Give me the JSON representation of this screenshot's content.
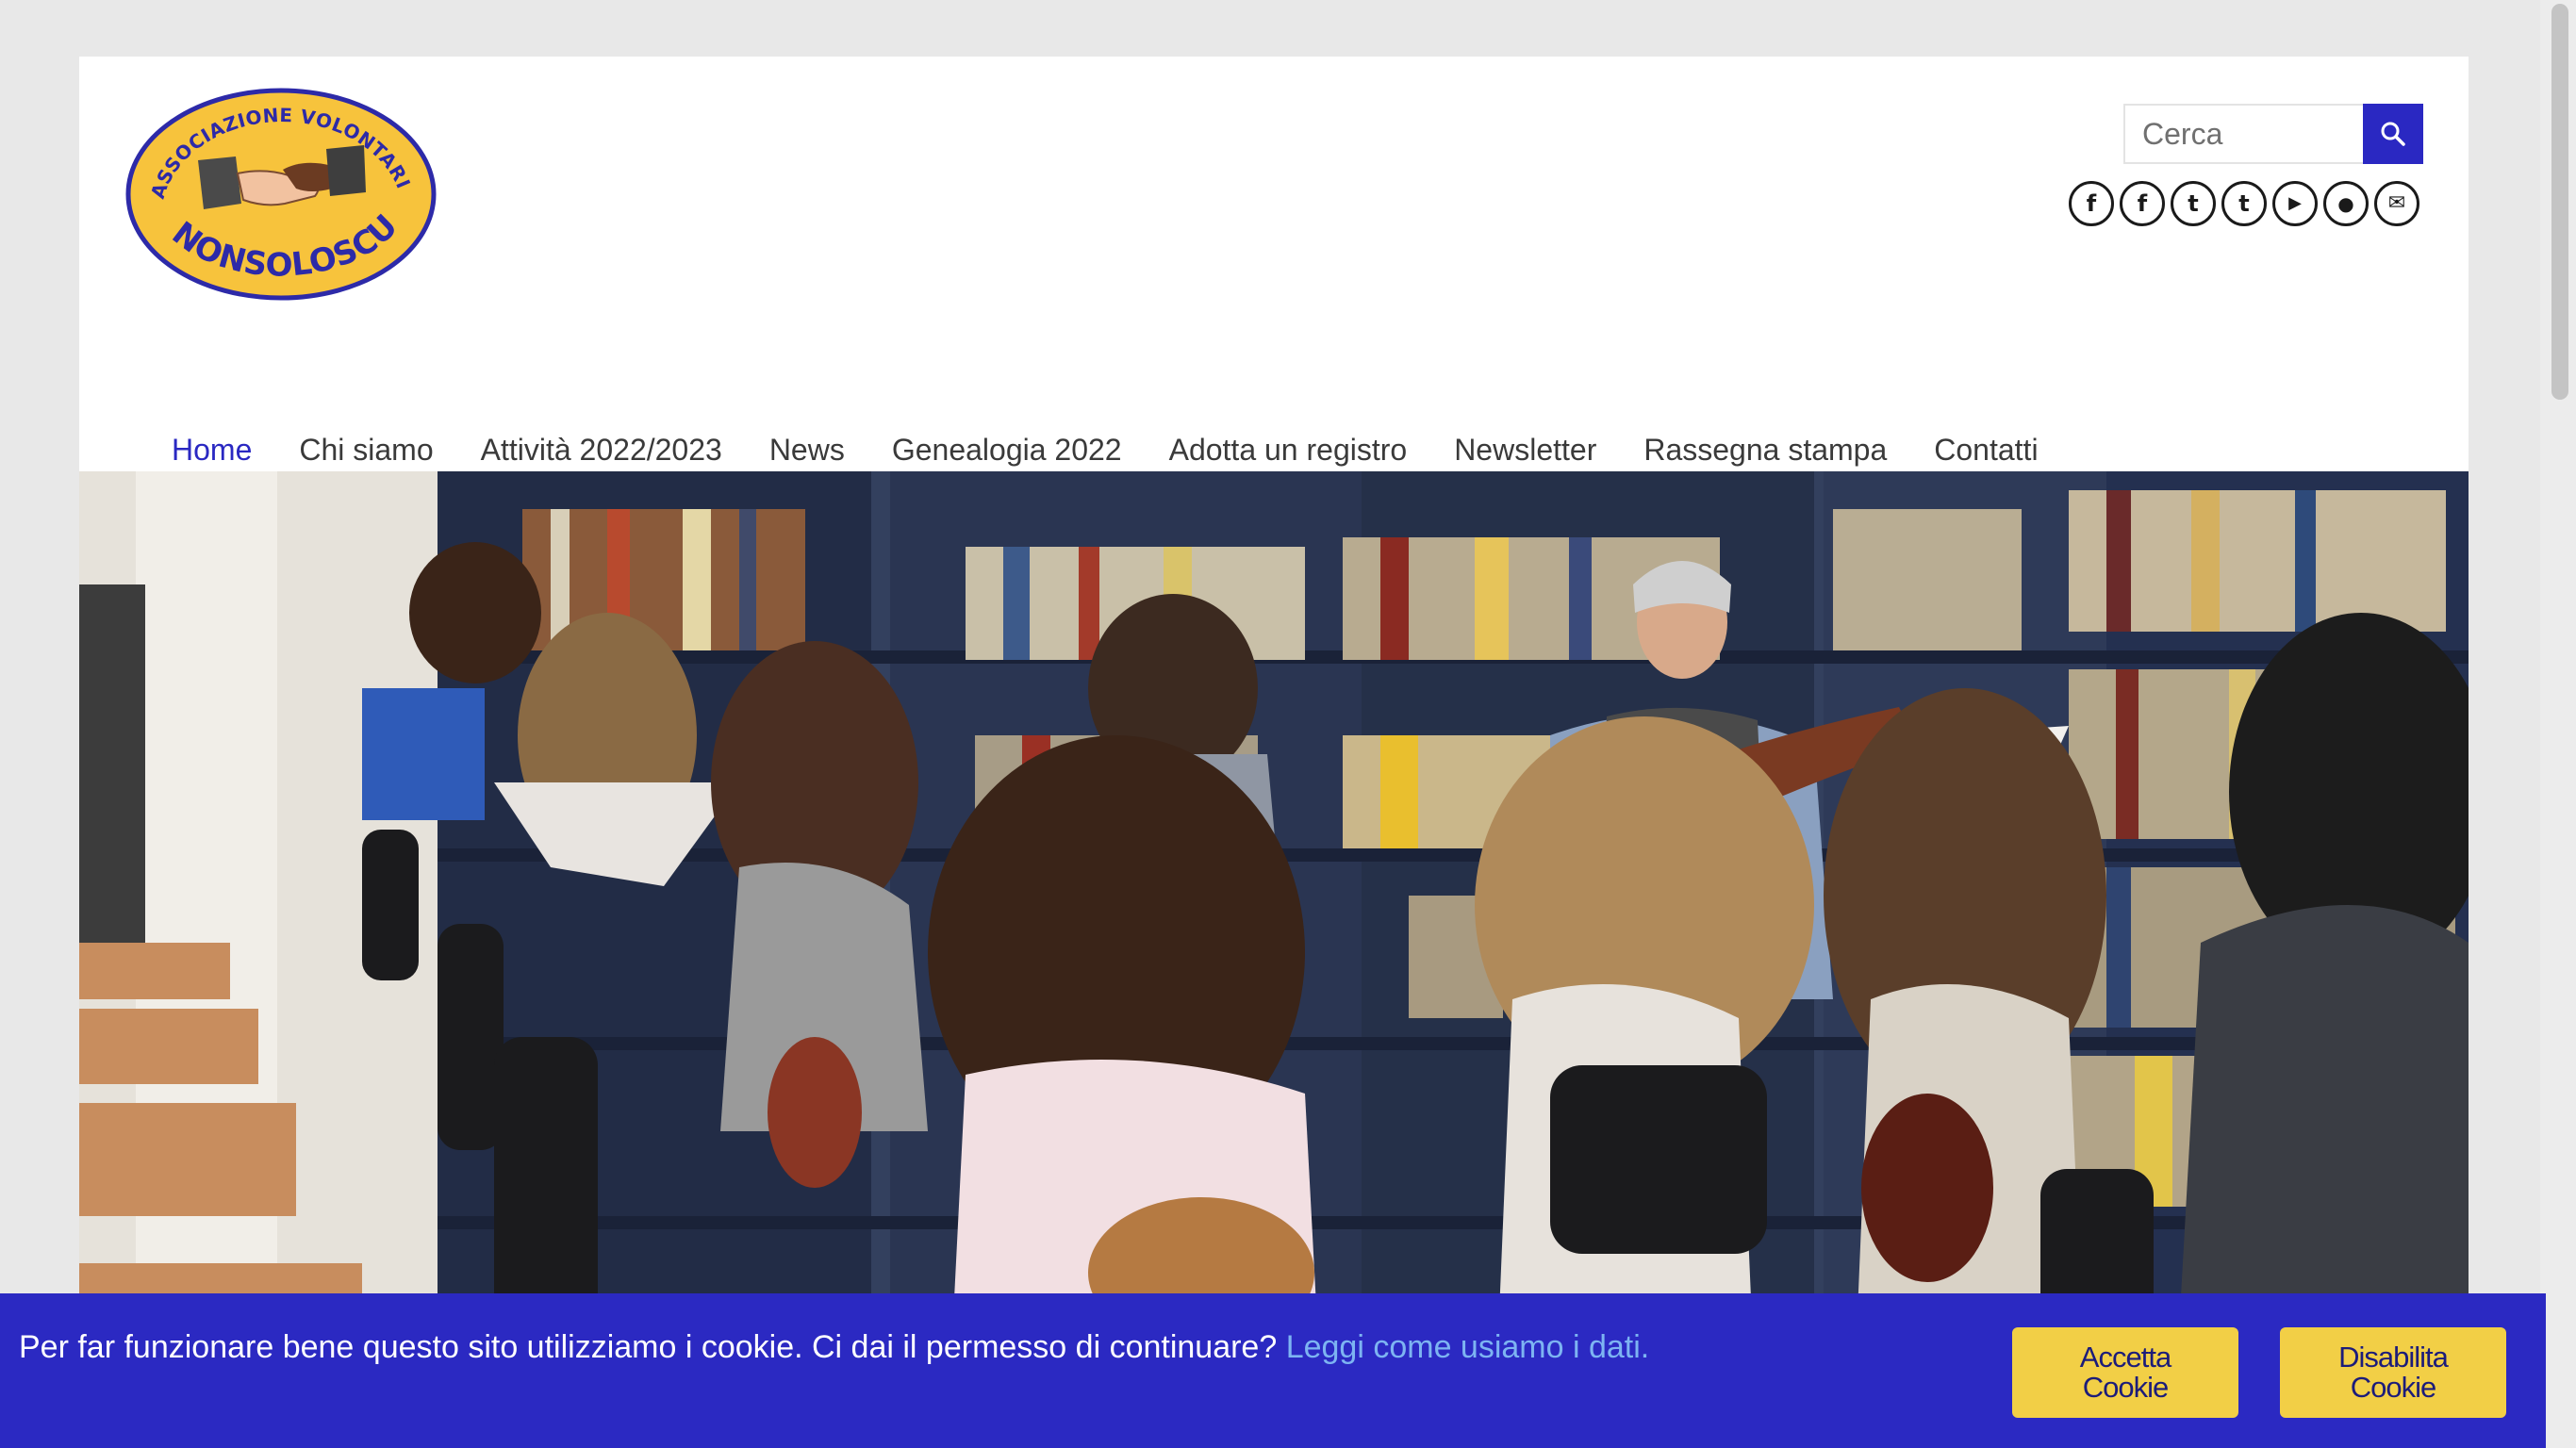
{
  "logo": {
    "text_top": "ASSOCIAZIONE VOLONTARIATO",
    "text_bottom": "NONSOLOSCUOLA"
  },
  "search": {
    "placeholder": "Cerca",
    "icon": "search-icon"
  },
  "social": [
    {
      "name": "facebook",
      "glyph": "f"
    },
    {
      "name": "facebook",
      "glyph": "f"
    },
    {
      "name": "twitter",
      "glyph": "t"
    },
    {
      "name": "twitter",
      "glyph": "t"
    },
    {
      "name": "youtube",
      "glyph": "▶"
    },
    {
      "name": "group",
      "glyph": "●"
    },
    {
      "name": "email",
      "glyph": "✉"
    }
  ],
  "nav": {
    "items": [
      {
        "label": "Home"
      },
      {
        "label": "Chi siamo"
      },
      {
        "label": "Attività 2022/2023"
      },
      {
        "label": "News"
      },
      {
        "label": "Genealogia 2022"
      },
      {
        "label": "Adotta un registro"
      },
      {
        "label": "Newsletter"
      },
      {
        "label": "Rassegna stampa"
      },
      {
        "label": "Contatti"
      }
    ]
  },
  "slider": {
    "slides": 5,
    "active_slide": 3
  },
  "cookie": {
    "message": "Per far funzionare bene questo sito utilizziamo i cookie. Ci dai il permesso di continuare? ",
    "link": "Leggi come usiamo i dati.",
    "accept_line1": "Accetta",
    "accept_line2": "Cookie",
    "disable_line1": "Disabilita",
    "disable_line2": "Cookie"
  },
  "colors": {
    "accent": "#2a28c2",
    "cookie_button": "#f2cf46",
    "link": "#7db4f2"
  }
}
